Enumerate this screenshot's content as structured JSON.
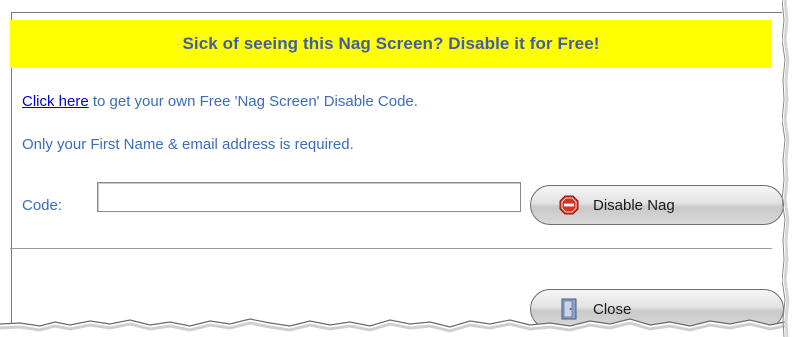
{
  "banner": {
    "text": "Sick of seeing this Nag Screen? Disable it for Free!"
  },
  "info": {
    "link_label": "Click here",
    "line1_rest": " to get your own Free 'Nag Screen' Disable Code.",
    "line2": "Only your First Name & email address is required."
  },
  "code": {
    "label": "Code:",
    "value": "",
    "placeholder": ""
  },
  "buttons": {
    "disable_label": "Disable Nag",
    "close_label": "Close"
  },
  "colors": {
    "banner_bg": "#ffff00",
    "banner_text": "#3f5ea8",
    "body_text": "#3b6cc0",
    "link": "#0000cc",
    "stop_icon": "#d83020"
  },
  "icons": {
    "disable": "stop-sign-icon",
    "close": "door-icon"
  }
}
